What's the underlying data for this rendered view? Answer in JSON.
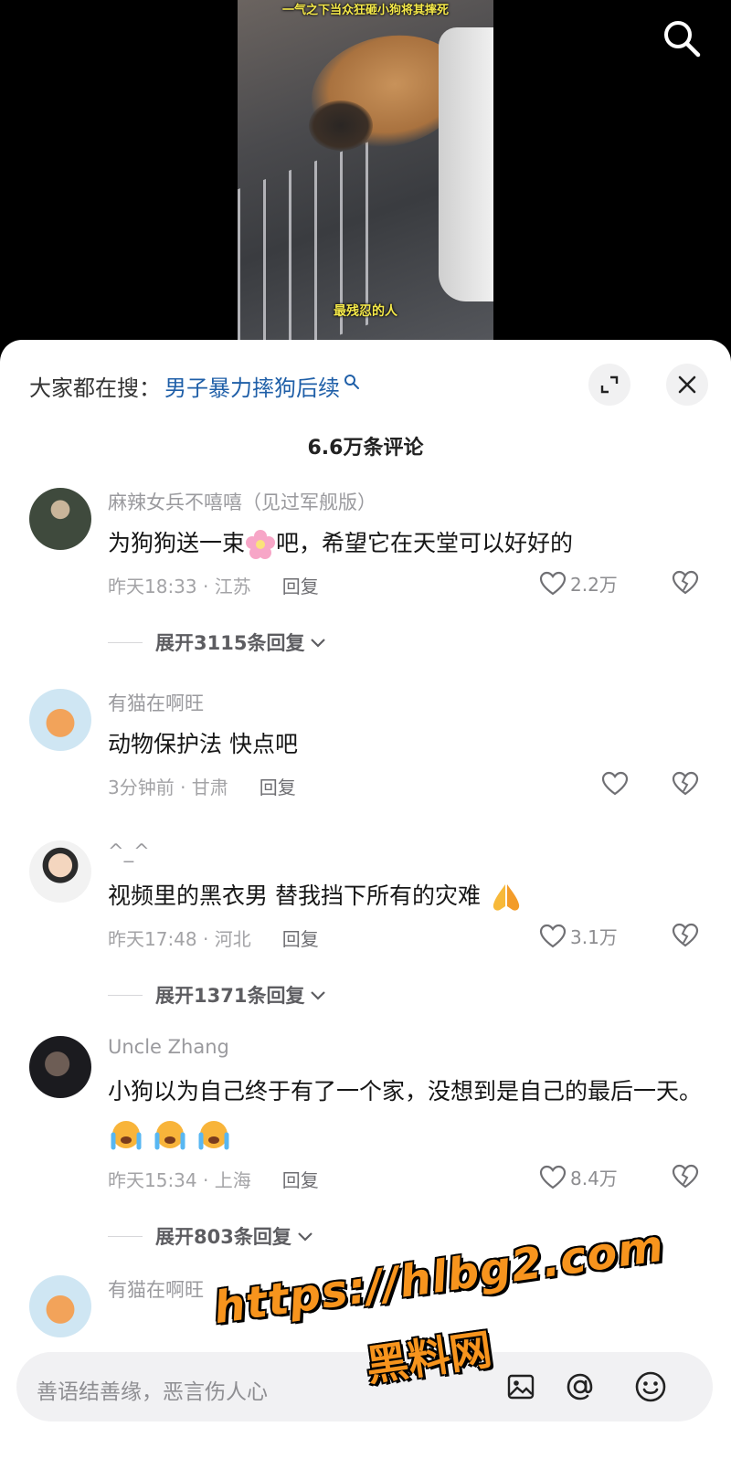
{
  "video": {
    "caption_top": "一气之下当众狂砸小狗将其摔死",
    "caption_bottom": "最残忍的人"
  },
  "sheet": {
    "trend_prefix": "大家都在搜：",
    "trend_link": "男子暴力摔狗后续",
    "comment_count": "6.6万条评论"
  },
  "comments": [
    {
      "username": "麻辣女兵不嘻嘻（见过军舰版）",
      "text": "为狗狗送一束",
      "text_after_emoji": "吧，希望它在天堂可以好好的",
      "time_loc": "昨天18:33 · 江苏",
      "reply": "回复",
      "likes": "2.2万",
      "expand": "展开3115条回复"
    },
    {
      "username": "有猫在啊旺",
      "text": "动物保护法 快点吧",
      "time_loc": "3分钟前 · 甘肃",
      "reply": "回复",
      "likes": ""
    },
    {
      "username": "^_^",
      "text": "视频里的黑衣男 替我挡下所有的灾难",
      "time_loc": "昨天17:48 · 河北",
      "reply": "回复",
      "likes": "3.1万",
      "expand": "展开1371条回复"
    },
    {
      "username": "Uncle Zhang",
      "text": "小狗以为自己终于有了一个家，没想到是自己的最后一天。",
      "time_loc": "昨天15:34 · 上海",
      "reply": "回复",
      "likes": "8.4万",
      "expand": "展开803条回复"
    },
    {
      "username": "有猫在啊旺"
    }
  ],
  "input": {
    "placeholder": "善语结善缘，恶言伤人心"
  },
  "watermark": {
    "url": "https://hlbg2.com",
    "name": "黑料网"
  },
  "icons": [
    "search-icon",
    "expand-icon",
    "close-icon",
    "heart-icon",
    "broken-heart-icon",
    "chevron-down-icon",
    "image-icon",
    "at-icon",
    "emoji-icon",
    "flower-emoji",
    "pray-emoji",
    "crying-emoji"
  ],
  "colors": {
    "link": "#1f5fa8",
    "watermark": "#f7941d"
  }
}
